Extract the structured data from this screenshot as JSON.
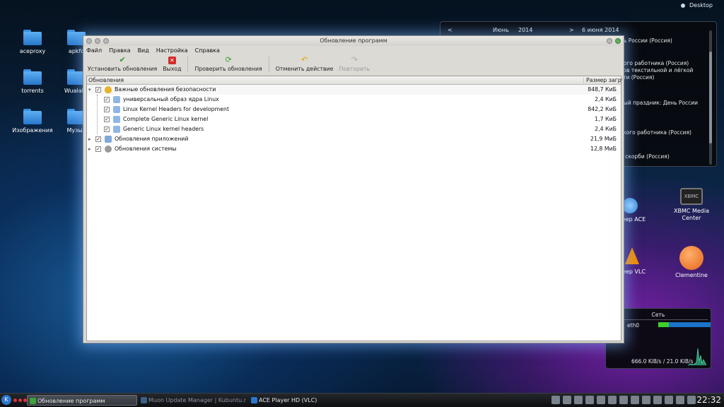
{
  "desktop": {
    "label": "Desktop",
    "icons": [
      {
        "label": "aceproxy"
      },
      {
        "label": "apkfo"
      },
      {
        "label": "torrents"
      },
      {
        "label": "WualaDr"
      },
      {
        "label": "Изображения"
      },
      {
        "label": "Музык"
      }
    ]
  },
  "calendar": {
    "prev": "<",
    "month": "Июнь",
    "year": "2014",
    "next": ">",
    "date": "6 июня 2014",
    "events": [
      "нь России (Россия)",
      "ного работника (Россия)",
      "ков текстильной и лёгкой",
      "сти (Россия)",
      "ный праздник: День России",
      "ского работника (Россия)",
      "и скорби (Россия)"
    ]
  },
  "right_apps": [
    {
      "label": "леер ACE"
    },
    {
      "label": "XBMC Media Center",
      "icon_text": "XBMC"
    },
    {
      "label": "леер VLC"
    },
    {
      "label": "Clementine"
    }
  ],
  "network": {
    "title": "Сеть",
    "interface": "eth0",
    "speed": "666.0 KiB/s / 21.0 KiB/s"
  },
  "window": {
    "title": "Обновление программ",
    "menu": [
      "Файл",
      "Правка",
      "Вид",
      "Настройка",
      "Справка"
    ],
    "toolbar": {
      "install": "Установить обновления",
      "quit": "Выход",
      "check": "Проверить обновления",
      "undo": "Отменить действие",
      "redo": "Повторить"
    },
    "columns": {
      "updates": "Обновления",
      "size": "Размер загру"
    },
    "rows": [
      {
        "name": "Важные обновления безопасности",
        "size": "848,7 КиБ"
      },
      {
        "name": "универсальный образ ядра Linux",
        "size": "2,4 КиБ"
      },
      {
        "name": "Linux Kernel Headers for development",
        "size": "842,2 КиБ"
      },
      {
        "name": "Complete Generic Linux kernel",
        "size": "1,7 КиБ"
      },
      {
        "name": "Generic Linux kernel headers",
        "size": "2,4 КиБ"
      },
      {
        "name": "Обновления приложений",
        "size": "21,9 МиБ"
      },
      {
        "name": "Обновления системы",
        "size": "12,8 МиБ"
      }
    ]
  },
  "taskbar": {
    "tasks": [
      "Обновление программ",
      "Muon Update Manager | Kubuntu.ru",
      "ACE Player HD (VLC)"
    ],
    "clock": "22:32"
  },
  "colors": {
    "accent": "#2a77cc",
    "selected_row": "#f7f7f7",
    "network_bar": "#1b74c7",
    "network_used": "#3ecf2a"
  }
}
